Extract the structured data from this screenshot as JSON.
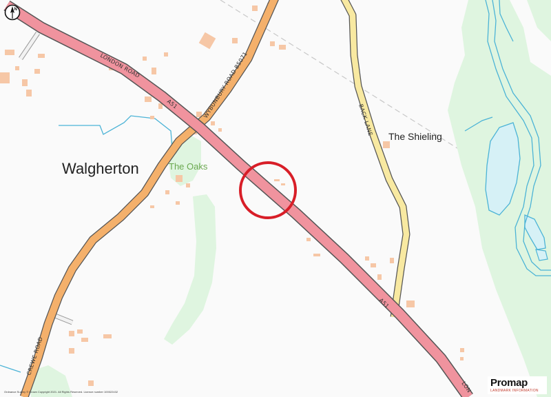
{
  "places": {
    "village": "Walgherton",
    "oaks": "The Oaks",
    "shieling": "The Shieling"
  },
  "roads": {
    "london_road_upper": "LONDON ROAD",
    "a51_upper": "A51",
    "wybunbury_road": "WYBUNBURY ROAD  B5071",
    "back_lane": "BACK LANE",
    "a51_lower": "A51",
    "london_road_lower": "LON",
    "crewe_road": "CREWE ROAD"
  },
  "compass": {
    "letter": "N"
  },
  "copyright": "Ordnance Survey © Crown Copyright 2021. All Rights Reserved. Licence number 100022432",
  "brand": {
    "name": "Promap",
    "sub": "LANDMARK INFORMATION"
  },
  "colors": {
    "a_road": "#f0939e",
    "b_road": "#f4b06b",
    "minor_road": "#f8e9a1",
    "woodland": "#dff5e0",
    "water": "#d6f1f6",
    "stream": "#4bb3d6",
    "building": "#f6c7a6",
    "marker": "#d81e28",
    "oaks_label": "#6aa84f"
  }
}
